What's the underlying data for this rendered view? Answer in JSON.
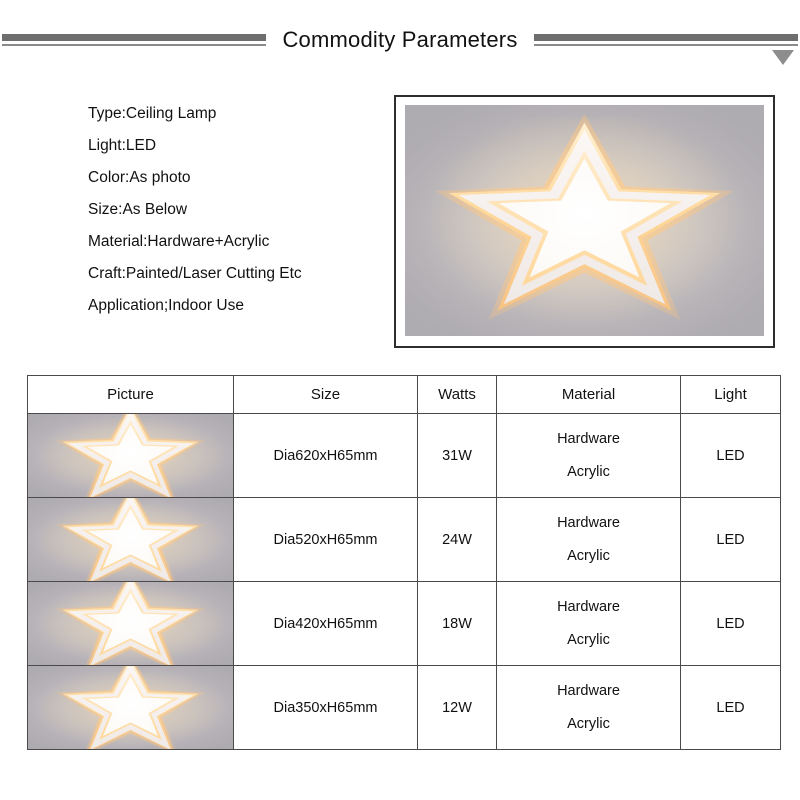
{
  "banner": {
    "title": "Commodity Parameters",
    "caret_icon": "chevron-down-icon",
    "rule_color": "#6e6e6e"
  },
  "specs": [
    "Type:Ceiling Lamp",
    "Light:LED",
    "Color:As photo",
    "Size:As Below",
    "Material:Hardware+Acrylic",
    "Craft:Painted/Laser Cutting Etc",
    "Application;Indoor Use"
  ],
  "hero_image": {
    "icon": "star-ceiling-lamp-photo",
    "alt": "Star shaped LED ceiling lamp glowing warm white",
    "background_color": "#b6b2b6",
    "glow_color": "#ffe4b4",
    "panel_color": "#ffffff"
  },
  "table": {
    "columns": [
      "Picture",
      "Size",
      "Watts",
      "Material",
      "Light"
    ],
    "rows": [
      {
        "picture_icon": "star-ceiling-lamp-thumbnail",
        "size": "Dia620xH65mm",
        "watts": "31W",
        "material_line1": "Hardware",
        "material_line2": "Acrylic",
        "light": "LED"
      },
      {
        "picture_icon": "star-ceiling-lamp-thumbnail",
        "size": "Dia520xH65mm",
        "watts": "24W",
        "material_line1": "Hardware",
        "material_line2": "Acrylic",
        "light": "LED"
      },
      {
        "picture_icon": "star-ceiling-lamp-thumbnail",
        "size": "Dia420xH65mm",
        "watts": "18W",
        "material_line1": "Hardware",
        "material_line2": "Acrylic",
        "light": "LED"
      },
      {
        "picture_icon": "star-ceiling-lamp-thumbnail",
        "size": "Dia350xH65mm",
        "watts": "12W",
        "material_line1": "Hardware",
        "material_line2": "Acrylic",
        "light": "LED"
      }
    ]
  }
}
